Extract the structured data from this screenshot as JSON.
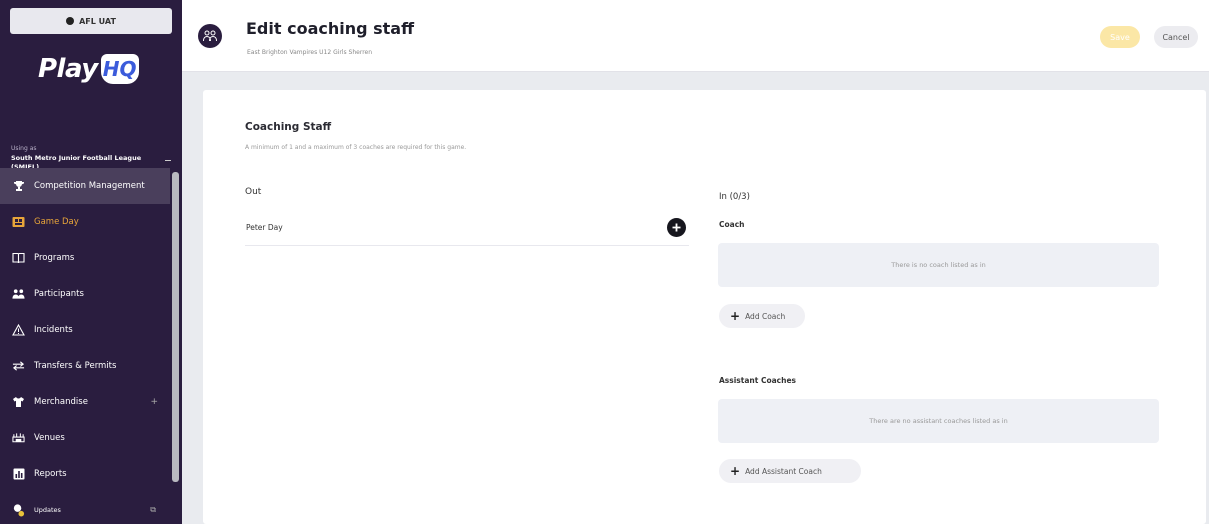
{
  "sidebar": {
    "env_badge": "AFL UAT",
    "logo": {
      "play": "Play",
      "hq": "HQ"
    },
    "org_label": "Using as",
    "org_name": "South Metro Junior Football League (SMJFL)",
    "items": [
      {
        "label": "Competition Management",
        "icon": "trophy-icon"
      },
      {
        "label": "Game Day",
        "icon": "game-day-icon"
      },
      {
        "label": "Programs",
        "icon": "book-icon"
      },
      {
        "label": "Participants",
        "icon": "people-icon"
      },
      {
        "label": "Incidents",
        "icon": "warning-icon"
      },
      {
        "label": "Transfers & Permits",
        "icon": "transfer-icon"
      },
      {
        "label": "Merchandise",
        "icon": "shirt-icon",
        "expand": "+"
      },
      {
        "label": "Venues",
        "icon": "stadium-icon"
      },
      {
        "label": "Reports",
        "icon": "chart-icon"
      },
      {
        "label": "Updates",
        "icon": "bell-icon"
      }
    ],
    "active_color": "#4a3f5c",
    "gameday_color": "#e8a53a",
    "bg_color": "#2a1d3f"
  },
  "header": {
    "title": "Edit coaching staff",
    "subtitle": "East Brighton Vampires U12 Girls Sherren",
    "save_label": "Save",
    "cancel_label": "Cancel"
  },
  "main": {
    "section_title": "Coaching Staff",
    "section_desc": "A minimum of 1 and a maximum of 3 coaches are required for this game.",
    "out": {
      "title": "Out",
      "people": [
        {
          "name": "Peter Day"
        }
      ]
    },
    "in": {
      "title": "In (0/3)",
      "coach_label": "Coach",
      "coach_empty": "There is no coach listed as in",
      "add_coach_label": "Add Coach",
      "assistant_label": "Assistant Coaches",
      "assistant_empty": "There are no assistant coaches listed as in",
      "add_assistant_label": "Add Assistant Coach"
    }
  }
}
